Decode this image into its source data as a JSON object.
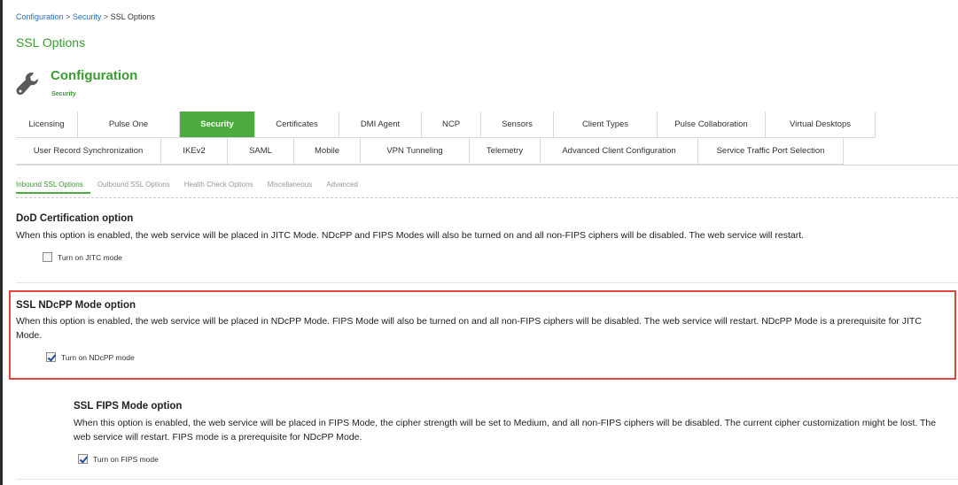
{
  "breadcrumb": {
    "items": [
      "Configuration",
      "Security",
      "SSL Options"
    ],
    "separator": ">"
  },
  "page_title": "SSL Options",
  "config": {
    "title": "Configuration",
    "subtitle": "Security",
    "icon": "wrench-icon"
  },
  "tabs": {
    "row1": [
      "Licensing",
      "Pulse One",
      "Security",
      "Certificates",
      "DMI Agent",
      "NCP",
      "Sensors",
      "Client Types",
      "Pulse Collaboration",
      "Virtual Desktops"
    ],
    "row2": [
      "User Record Synchronization",
      "IKEv2",
      "SAML",
      "Mobile",
      "VPN Tunneling",
      "Telemetry",
      "Advanced Client Configuration",
      "Service Traffic Port Selection"
    ],
    "active": "Security"
  },
  "subtabs": {
    "items": [
      "Inbound SSL Options",
      "Outbound SSL Options",
      "Health Check Options",
      "Miscellaneous",
      "Advanced"
    ],
    "active": "Inbound SSL Options"
  },
  "sections": [
    {
      "title": "DoD Certification option",
      "description": "When this option is enabled, the web service will be placed in JITC Mode. NDcPP and FIPS Modes will also be turned on and all non-FIPS ciphers will be disabled. The web service will restart.",
      "checkbox_label": "Turn on JITC mode",
      "checked": false
    },
    {
      "title": "SSL NDcPP Mode option",
      "description": "When this option is enabled, the web service will be placed in NDcPP Mode. FIPS Mode will also be turned on and all non-FIPS ciphers will be disabled. The web service will restart. NDcPP Mode is a prerequisite for JITC Mode.",
      "checkbox_label": "Turn on NDcPP mode",
      "checked": true
    },
    {
      "title": "SSL FIPS Mode option",
      "description": "When this option is enabled, the web service will be placed in FIPS Mode, the cipher strength will be set to Medium, and all non-FIPS ciphers will be disabled. The current cipher customization might be lost. The web service will restart. FIPS mode is a prerequisite for NDcPP Mode.",
      "checkbox_label": "Turn on FIPS mode",
      "checked": true
    }
  ],
  "colors": {
    "accent_green": "#4cab3f",
    "title_green": "#3a9c2f",
    "link_blue": "#2a6ebb",
    "highlight_red": "#e2453c"
  }
}
